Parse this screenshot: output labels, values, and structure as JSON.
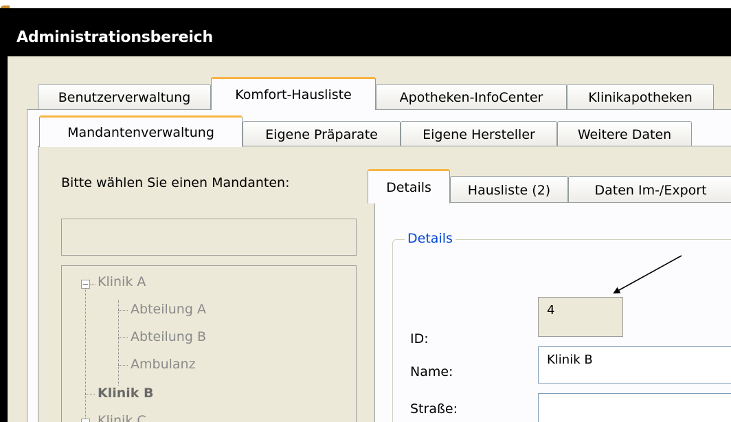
{
  "window": {
    "title": "Administrationsbereich"
  },
  "main_tabs": [
    "Benutzerverwaltung",
    "Komfort-Hausliste",
    "Apotheken-InfoCenter",
    "Klinikapotheken"
  ],
  "main_tabs_active": "Komfort-Hausliste",
  "sub_tabs": [
    "Mandantenverwaltung",
    "Eigene Präparate",
    "Eigene Hersteller",
    "Weitere Daten"
  ],
  "sub_tabs_active": "Mandantenverwaltung",
  "mandant_panel": {
    "prompt": "Bitte wählen Sie einen Mandanten:",
    "filter_value": "",
    "tree": [
      {
        "label": "Klinik A",
        "bold": false,
        "level": 0,
        "expanded": true
      },
      {
        "label": "Abteilung A",
        "bold": false,
        "level": 1
      },
      {
        "label": "Abteilung B",
        "bold": false,
        "level": 1
      },
      {
        "label": "Ambulanz",
        "bold": false,
        "level": 1
      },
      {
        "label": "Klinik B",
        "bold": true,
        "level": 0
      },
      {
        "label": "Klinik C",
        "bold": false,
        "level": 0,
        "expanded": true
      }
    ]
  },
  "detail_tabs": [
    "Details",
    "Hausliste (2)",
    "Daten Im-/Export"
  ],
  "detail_tabs_active": "Details",
  "details": {
    "group_title": "Details",
    "fields": [
      {
        "label": "ID:",
        "value": "4",
        "readonly": true
      },
      {
        "label": "Name:",
        "value": "Klinik B",
        "readonly": false
      },
      {
        "label": "Straße:",
        "value": "",
        "readonly": false
      }
    ]
  },
  "colors": {
    "active_tab_accent": "#f7b443",
    "group_caption": "#0046d5",
    "titlebar": "#000000"
  }
}
